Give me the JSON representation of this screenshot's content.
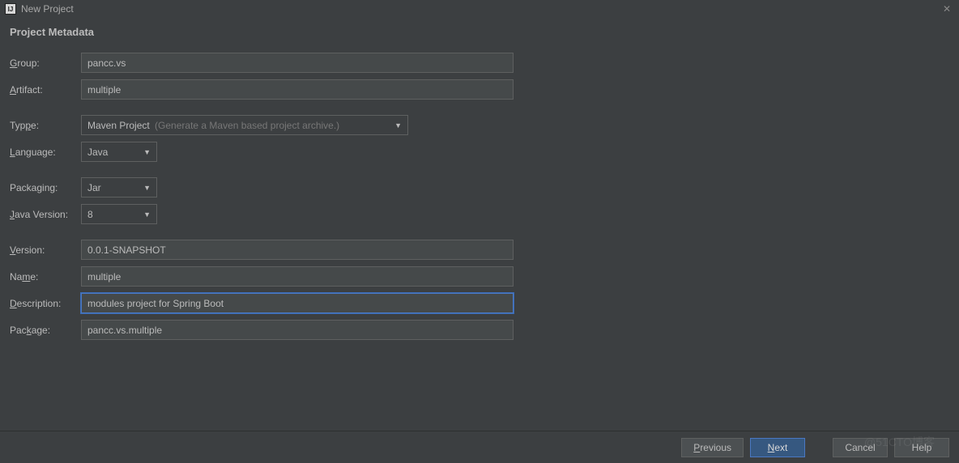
{
  "window": {
    "title": "New Project",
    "close": "✕"
  },
  "section_title": "Project Metadata",
  "labels": {
    "group": "roup:",
    "group_u": "G",
    "artifact": "rtifact:",
    "artifact_u": "A",
    "type": "e:",
    "type_u": "Typ",
    "language": "anguage:",
    "language_u": "L",
    "packaging": "Packaging:",
    "java_version": "ava Version:",
    "java_version_u": "J",
    "version": "ersion:",
    "version_u": "V",
    "name": "e:",
    "name_pre": "Na",
    "name_u": "m",
    "description": "escription:",
    "description_u": "D",
    "package": "age:",
    "package_pre": "Pac",
    "package_u": "k"
  },
  "fields": {
    "group": "pancc.vs",
    "artifact": "multiple",
    "type": "Maven Project",
    "type_hint": "(Generate a Maven based project archive.)",
    "language": "Java",
    "packaging": "Jar",
    "java_version": "8",
    "version": "0.0.1-SNAPSHOT",
    "name": "multiple",
    "description": "modules project for Spring Boot",
    "package": "pancc.vs.multiple"
  },
  "buttons": {
    "previous": "revious",
    "previous_u": "P",
    "next": "ext",
    "next_u": "N",
    "cancel": "Cancel",
    "help": "Help"
  },
  "watermark": "@51CTO博客"
}
